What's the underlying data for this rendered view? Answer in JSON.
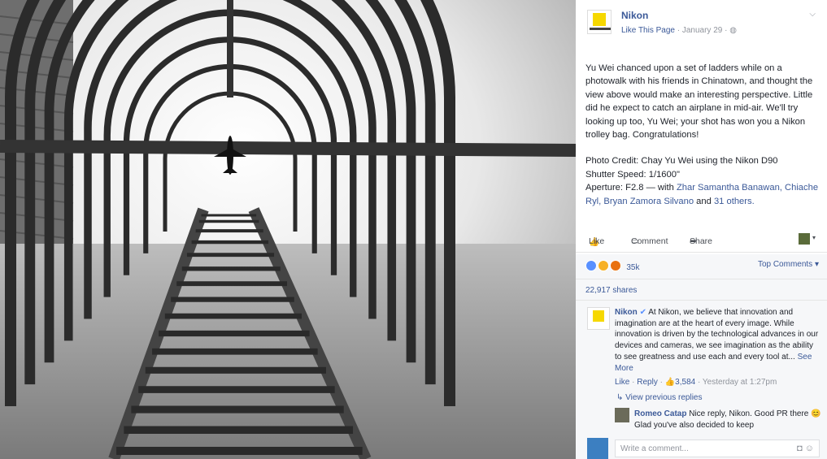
{
  "page": {
    "name": "Nikon",
    "like_link": "Like This Page",
    "date": "January 29"
  },
  "post": {
    "caption": "Yu Wei chanced upon a set of ladders while on a photowalk with his friends in Chinatown, and thought the view above would make an interesting perspective. Little did he expect to catch an airplane in mid-air. We'll try looking up too, Yu Wei; your shot has won you a Nikon trolley bag. Congratulations!",
    "credit": "Photo Credit: Chay Yu Wei using the Nikon D90",
    "shutter": "Shutter Speed: 1/1600\"",
    "aperture": "Aperture: F2.8",
    "with_text": "— with",
    "tagged_people": "Zhar Samantha Banawan, Chiache Ryl, Bryan Zamora Silvano",
    "and_text": "and",
    "others": "31 others."
  },
  "actions": {
    "like": "Like",
    "comment": "Comment",
    "share": "Share"
  },
  "reactions": {
    "count": "35k",
    "top_comments": "Top Comments",
    "shares": "22,917 shares",
    "colors": [
      "#5890ff",
      "#f7b125",
      "#e9710f"
    ]
  },
  "comment": {
    "author": "Nikon",
    "text": "At Nikon, we believe that innovation and imagination are at the heart of every image. While innovation is driven by the technological advances in our devices and cameras, we see imagination as the ability to see greatness and use each and every tool at...",
    "see_more": "See More",
    "like": "Like",
    "reply": "Reply",
    "likes": "3,584",
    "time": "Yesterday at 1:27pm"
  },
  "view_previous": "View previous replies",
  "reply": {
    "author": "Romeo Catap",
    "text": "Nice reply, Nikon. Good PR there 😊 Glad you've also decided to keep"
  },
  "comment_box": {
    "placeholder": "Write a comment..."
  },
  "icons": [
    "globe-icon",
    "chevron-down-icon",
    "thumbs-up-icon",
    "comment-icon",
    "share-icon",
    "reply-arrow-icon",
    "camera-icon",
    "sticker-icon"
  ]
}
